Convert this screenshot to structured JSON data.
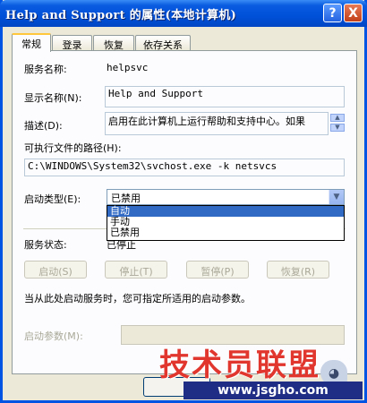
{
  "window": {
    "title": "Help and Support 的属性(本地计算机)",
    "help_btn": "?",
    "close_btn": "X"
  },
  "tabs": [
    "常规",
    "登录",
    "恢复",
    "依存关系"
  ],
  "general": {
    "service_name_label": "服务名称:",
    "service_name_value": "helpsvc",
    "display_name_label": "显示名称(N):",
    "display_name_value": "Help and Support",
    "description_label": "描述(D):",
    "description_value": "启用在此计算机上运行帮助和支持中心。如果",
    "path_label": "可执行文件的路径(H):",
    "path_value": "C:\\WINDOWS\\System32\\svchost.exe -k netsvcs",
    "startup_type_label": "启动类型(E):",
    "startup_type_selected": "已禁用",
    "startup_options": [
      "自动",
      "手动",
      "已禁用"
    ],
    "highlighted_option": "自动",
    "status_label": "服务状态:",
    "status_value": "已停止",
    "buttons": {
      "start": "启动(S)",
      "stop": "停止(T)",
      "pause": "暂停(P)",
      "resume": "恢复(R)"
    },
    "hint": "当从此处启动服务时，您可指定所适用的启动参数。",
    "params_label": "启动参数(M):",
    "params_value": ""
  },
  "watermark": {
    "text": "技术员联盟",
    "url": "www.jsgho.com"
  }
}
